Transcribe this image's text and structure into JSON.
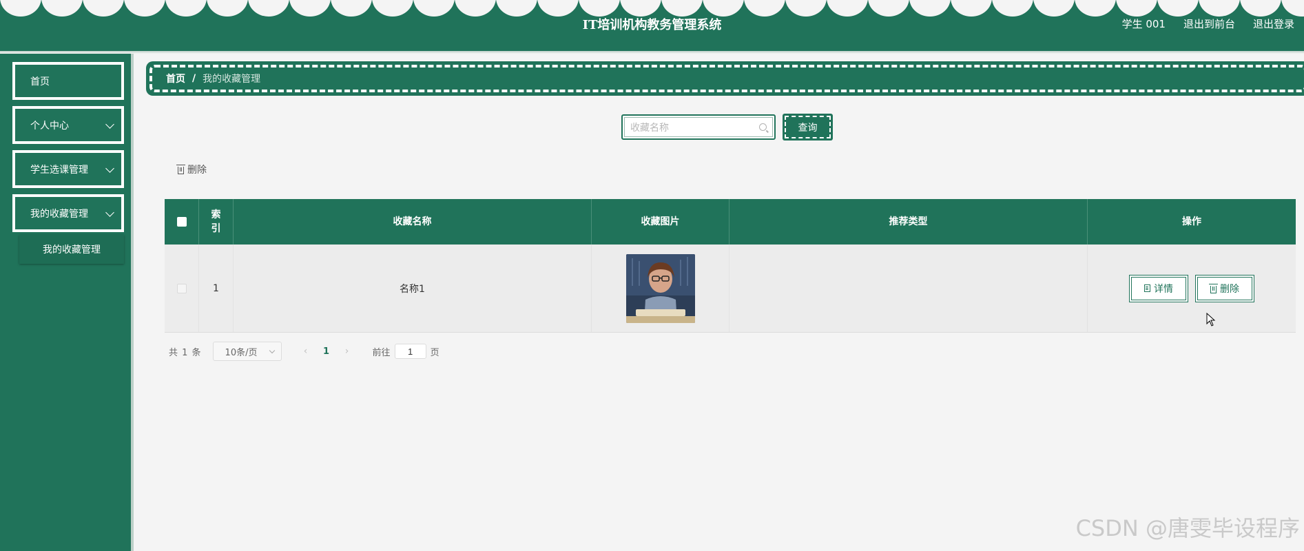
{
  "header": {
    "title": "IT培训机构教务管理系统",
    "user_label": "学生 001",
    "back_to_front": "退出到前台",
    "logout": "退出登录"
  },
  "sidebar": {
    "items": [
      {
        "label": "首页"
      },
      {
        "label": "个人中心"
      },
      {
        "label": "学生选课管理"
      },
      {
        "label": "我的收藏管理"
      }
    ],
    "sub_item": "我的收藏管理"
  },
  "breadcrumb": {
    "home": "首页",
    "separator": "/",
    "current": "我的收藏管理"
  },
  "search": {
    "placeholder": "收藏名称",
    "value": "",
    "button_label": "查询"
  },
  "toolbar": {
    "delete_label": "删除"
  },
  "table": {
    "headers": {
      "index_line1": "索",
      "index_line2": "引",
      "name": "收藏名称",
      "image": "收藏图片",
      "type": "推荐类型",
      "operation": "操作"
    },
    "rows": [
      {
        "index": "1",
        "name": "名称1",
        "type": "",
        "detail_label": "详情",
        "delete_label": "删除"
      }
    ]
  },
  "pagination": {
    "total_text": "共 1 条",
    "page_size": "10条/页",
    "current_page": "1",
    "goto_prefix": "前往",
    "goto_value": "1",
    "goto_suffix": "页"
  },
  "watermark": "CSDN @唐雯毕设程序",
  "colors": {
    "primary": "#20735a",
    "background": "#f4f4f4",
    "row_background": "#ececec"
  }
}
